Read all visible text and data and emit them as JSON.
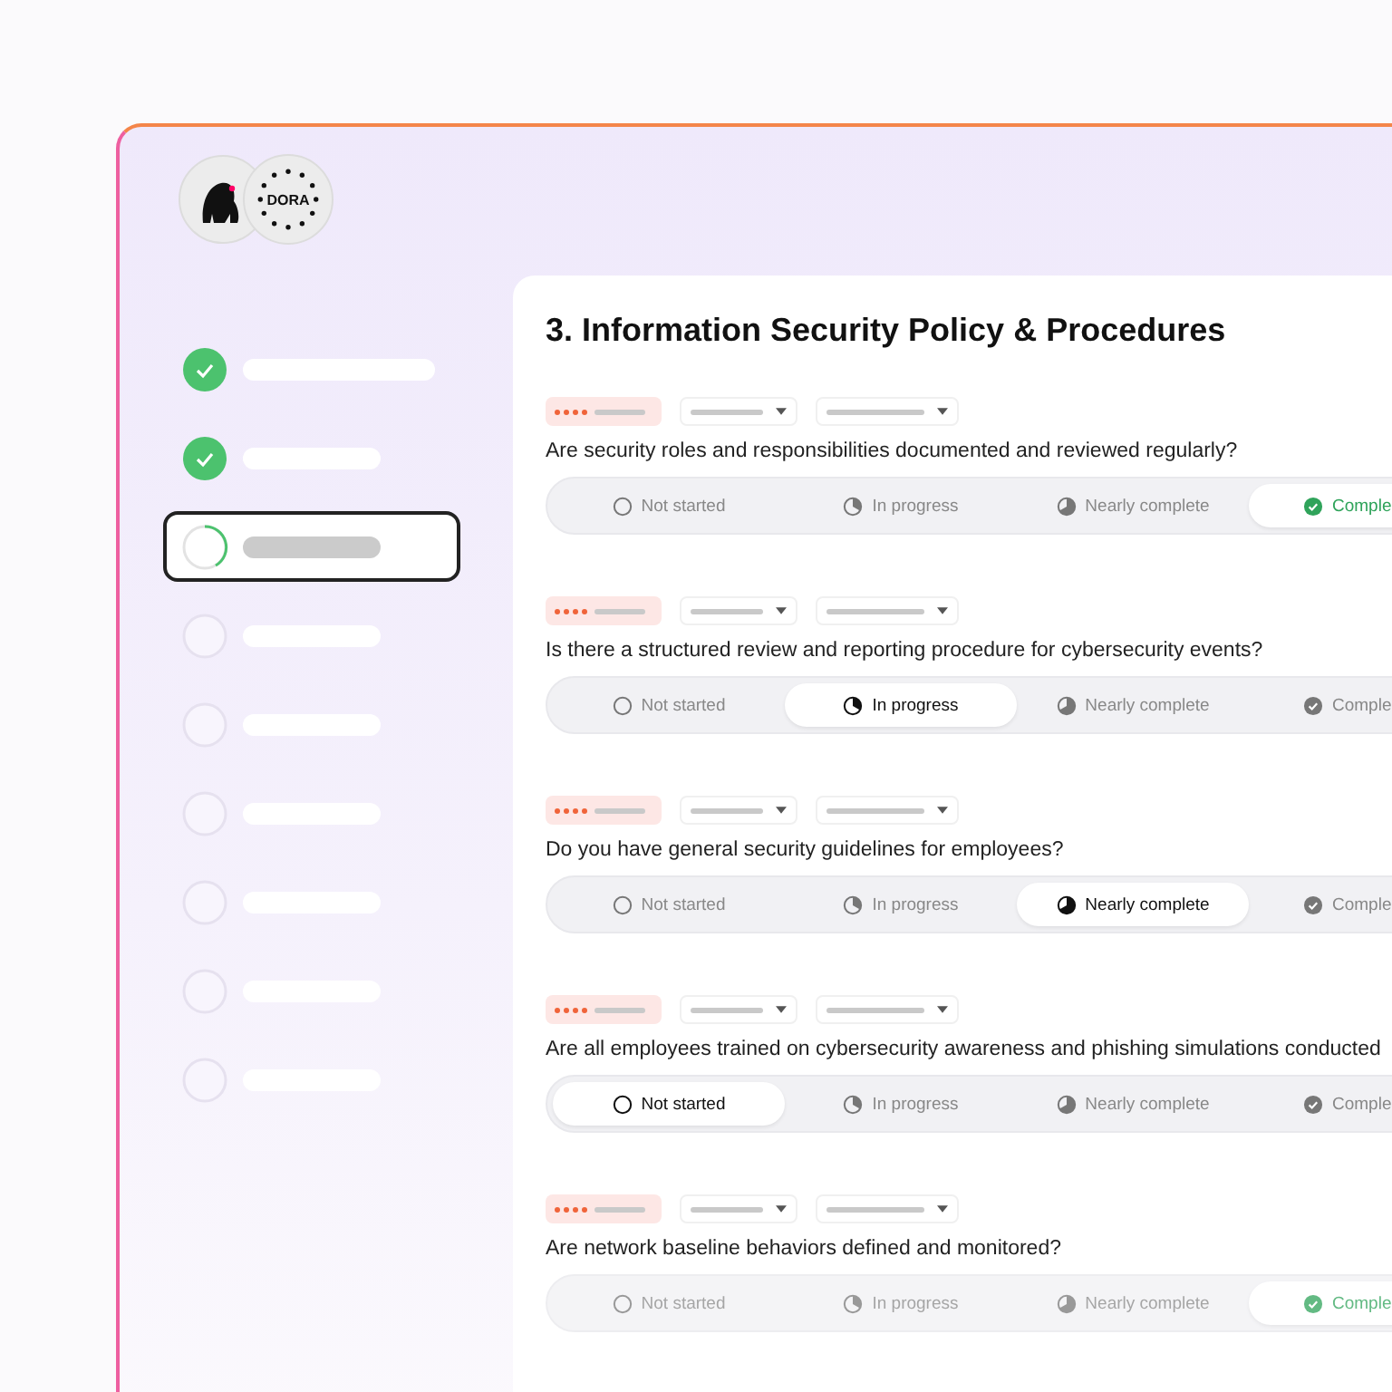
{
  "logo": {
    "badge_text": "DORA"
  },
  "steps": [
    {
      "completed": true,
      "current": false
    },
    {
      "completed": true,
      "current": false
    },
    {
      "completed": false,
      "current": true
    },
    {
      "completed": false,
      "current": false
    },
    {
      "completed": false,
      "current": false
    },
    {
      "completed": false,
      "current": false
    },
    {
      "completed": false,
      "current": false
    },
    {
      "completed": false,
      "current": false
    },
    {
      "completed": false,
      "current": false
    }
  ],
  "section": {
    "title": "3. Information Security Policy & Procedures",
    "questions": [
      {
        "text": "Are security roles and responsibilities documented and reviewed regularly?",
        "options": [
          {
            "label": "Not started",
            "kind": "empty",
            "selected": false
          },
          {
            "label": "In progress",
            "kind": "quarter",
            "selected": false
          },
          {
            "label": "Nearly complete",
            "kind": "three-quarter",
            "selected": false
          },
          {
            "label": "Comple",
            "kind": "done",
            "selected": true
          }
        ]
      },
      {
        "text": "Is there a structured review and reporting procedure for cybersecurity events?",
        "options": [
          {
            "label": "Not started",
            "kind": "empty",
            "selected": false
          },
          {
            "label": "In progress",
            "kind": "quarter",
            "selected": true
          },
          {
            "label": "Nearly complete",
            "kind": "three-quarter",
            "selected": false
          },
          {
            "label": "Comple",
            "kind": "done",
            "selected": false
          }
        ]
      },
      {
        "text": "Do you have general security guidelines for employees?",
        "options": [
          {
            "label": "Not started",
            "kind": "empty",
            "selected": false
          },
          {
            "label": "In progress",
            "kind": "quarter",
            "selected": false
          },
          {
            "label": "Nearly complete",
            "kind": "three-quarter",
            "selected": true
          },
          {
            "label": "Comple",
            "kind": "done",
            "selected": false
          }
        ]
      },
      {
        "text": "Are all employees trained on cybersecurity awareness and phishing simulations conducted",
        "options": [
          {
            "label": "Not started",
            "kind": "empty",
            "selected": true
          },
          {
            "label": "In progress",
            "kind": "quarter",
            "selected": false
          },
          {
            "label": "Nearly complete",
            "kind": "three-quarter",
            "selected": false
          },
          {
            "label": "Comple",
            "kind": "done",
            "selected": false
          }
        ]
      },
      {
        "text": "Are network baseline behaviors defined and monitored?",
        "options": [
          {
            "label": "Not started",
            "kind": "empty",
            "selected": false
          },
          {
            "label": "In progress",
            "kind": "quarter",
            "selected": false
          },
          {
            "label": "Nearly complete",
            "kind": "three-quarter",
            "selected": false
          },
          {
            "label": "Comple",
            "kind": "done",
            "selected": true
          }
        ]
      }
    ]
  }
}
